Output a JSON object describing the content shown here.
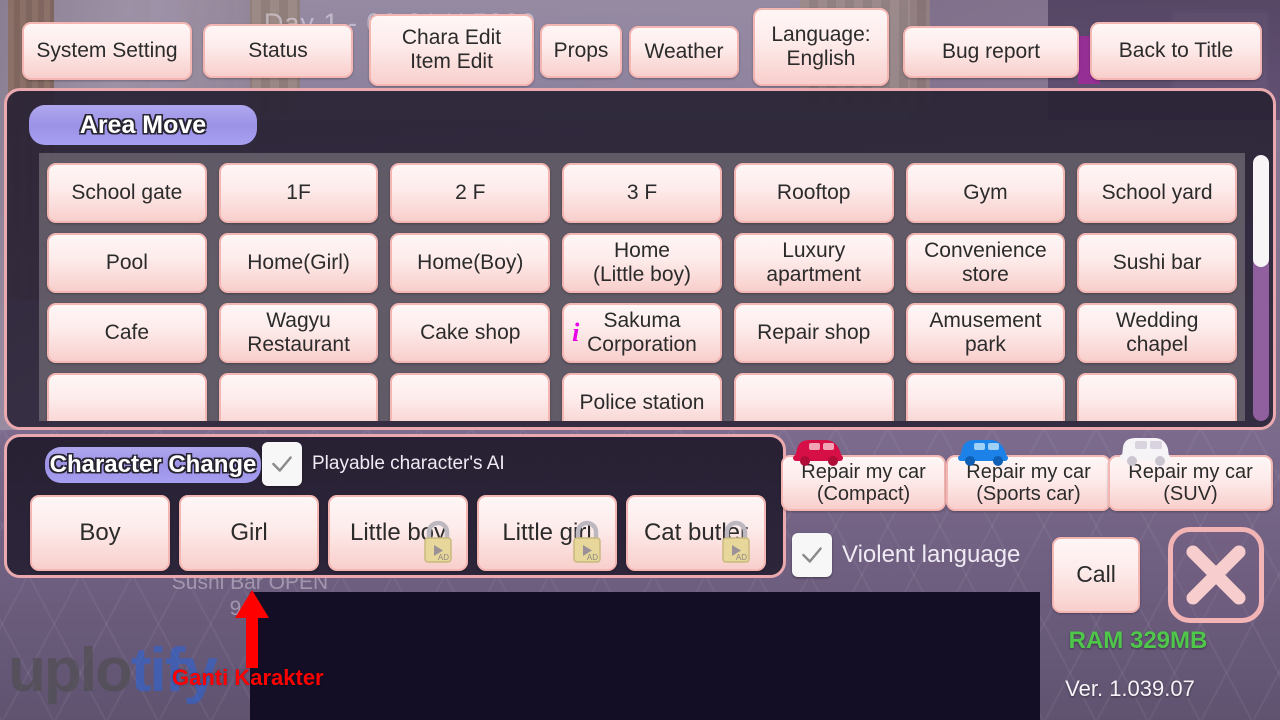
{
  "background": {
    "hud_status": "Day 1 - 09:01   ¥ 5000",
    "event_line1": "Sushi Bar OPEN",
    "event_line2": "9:00"
  },
  "topbar": {
    "buttons": [
      {
        "label": "System Setting",
        "name": "system-setting-button"
      },
      {
        "label": "Status",
        "name": "status-button"
      },
      {
        "label": "Chara Edit\nItem Edit",
        "name": "chara-item-edit-button"
      },
      {
        "label": "Props",
        "name": "props-button"
      },
      {
        "label": "Weather",
        "name": "weather-button"
      },
      {
        "label": "Language:\nEnglish",
        "name": "language-button"
      },
      {
        "label": "Bug report",
        "name": "bug-report-button"
      },
      {
        "label": "Back to Title",
        "name": "back-to-title-button"
      }
    ]
  },
  "area_move": {
    "title": "Area Move",
    "scroll_thumb_percent": 42,
    "items": [
      {
        "label": "School gate",
        "info": false
      },
      {
        "label": "1F",
        "info": false
      },
      {
        "label": "2 F",
        "info": false
      },
      {
        "label": "3 F",
        "info": false
      },
      {
        "label": "Rooftop",
        "info": false
      },
      {
        "label": "Gym",
        "info": false
      },
      {
        "label": "School yard",
        "info": false
      },
      {
        "label": "Pool",
        "info": false
      },
      {
        "label": "Home(Girl)",
        "info": false
      },
      {
        "label": "Home(Boy)",
        "info": false
      },
      {
        "label": "Home\n(Little boy)",
        "info": false
      },
      {
        "label": "Luxury\napartment",
        "info": false
      },
      {
        "label": "Convenience\nstore",
        "info": false
      },
      {
        "label": "Sushi bar",
        "info": false
      },
      {
        "label": "Cafe",
        "info": false
      },
      {
        "label": "Wagyu\nRestaurant",
        "info": false
      },
      {
        "label": "Cake shop",
        "info": false
      },
      {
        "label": "Sakuma\nCorporation",
        "info": true
      },
      {
        "label": "Repair shop",
        "info": false
      },
      {
        "label": "Amusement\npark",
        "info": false
      },
      {
        "label": "Wedding\nchapel",
        "info": false
      },
      {
        "label": "",
        "info": false
      },
      {
        "label": "",
        "info": false
      },
      {
        "label": "",
        "info": false
      },
      {
        "label": "Police station",
        "info": false
      },
      {
        "label": "",
        "info": false
      },
      {
        "label": "",
        "info": false
      },
      {
        "label": "",
        "info": false
      }
    ]
  },
  "character_change": {
    "title": "Character Change",
    "ai_checkbox": {
      "label": "Playable character's AI",
      "checked": true
    },
    "characters": [
      {
        "label": "Boy",
        "locked": false
      },
      {
        "label": "Girl",
        "locked": false
      },
      {
        "label": "Little boy",
        "locked": true,
        "lock_badge": "AD"
      },
      {
        "label": "Little girl",
        "locked": true,
        "lock_badge": "AD"
      },
      {
        "label": "Cat butler",
        "locked": true,
        "lock_badge": "AD"
      }
    ]
  },
  "car_repair": [
    {
      "label": "Repair my car\n(Compact)",
      "icon": "car-icon-red",
      "color": "#d61046"
    },
    {
      "label": "Repair my car\n(Sports car)",
      "icon": "car-icon-blue",
      "color": "#1c82e8"
    },
    {
      "label": "Repair my car\n(SUV)",
      "icon": "car-icon-white",
      "color": "#f6f4f7"
    }
  ],
  "options": {
    "violent_checkbox": {
      "label": "Violent language",
      "checked": true
    },
    "call_label": "Call",
    "close_icon": "close-x-icon"
  },
  "status": {
    "ram": "RAM 329MB",
    "version": "Ver. 1.039.07",
    "ram_color": "#4ec74a"
  },
  "annotation": {
    "text": "Ganti Karakter",
    "arrow": "up-arrow-icon",
    "color": "#ff0000"
  },
  "watermark": {
    "part_a": "uplo",
    "part_b": "tify"
  }
}
